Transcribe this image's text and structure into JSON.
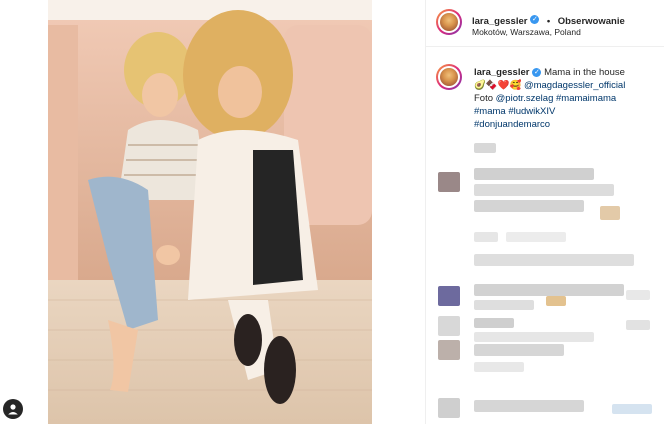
{
  "header": {
    "username": "lara_gessler",
    "dot": "•",
    "follow_label": "Obserwowanie",
    "location": "Mokotów, Warszawa, Poland"
  },
  "caption": {
    "username": "lara_gessler",
    "text": "Mama in the house",
    "emojis": "🥑🍫❤️🥰",
    "mention": "@magdagessler_official",
    "photo_prefix": "Foto",
    "photo_credit": "@piotr.szelag",
    "tag1": "#mamaimama",
    "tag2": "#mama",
    "tag3": "#ludwikXIV",
    "tag4": "#donjuandemarco"
  },
  "icons": {
    "verified": "verified-badge-icon",
    "profile": "user-profile-icon"
  },
  "colors": {
    "link": "#00376b",
    "verified": "#3897f0",
    "text": "#262626",
    "divider": "#efefef"
  }
}
